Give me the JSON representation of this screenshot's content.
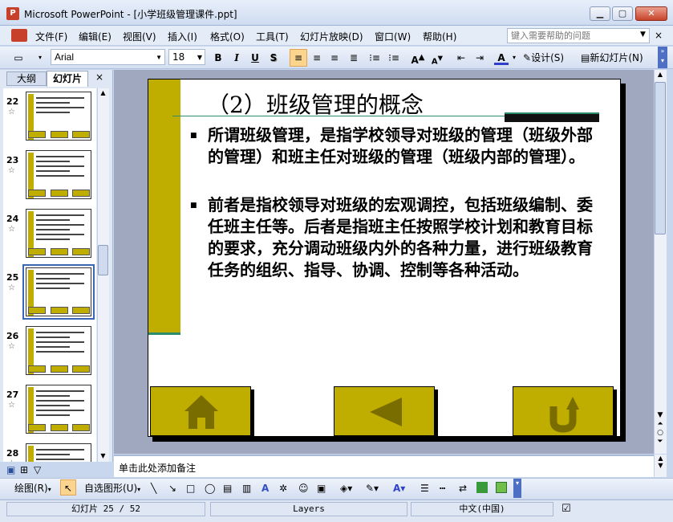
{
  "window": {
    "title": "Microsoft PowerPoint - [小学班级管理课件.ppt]",
    "app_icon": "P",
    "minimize": "▁",
    "maximize": "▢",
    "close": "✕"
  },
  "menu": {
    "items": [
      "文件(F)",
      "编辑(E)",
      "视图(V)",
      "插入(I)",
      "格式(O)",
      "工具(T)",
      "幻灯片放映(D)",
      "窗口(W)",
      "帮助(H)"
    ],
    "help_placeholder": "键入需要帮助的问题",
    "close": "×"
  },
  "toolbar": {
    "font": "Arial",
    "size": "18",
    "bold": "B",
    "italic": "I",
    "underline": "U",
    "shadow": "S",
    "design": "设计(S)",
    "new_slide": "新幻灯片(N)"
  },
  "left_panel": {
    "tab_outline": "大纲",
    "tab_slides": "幻灯片",
    "close": "×",
    "thumbnails": [
      {
        "number": "22",
        "star": "☆"
      },
      {
        "number": "23",
        "star": "☆"
      },
      {
        "number": "24",
        "star": "☆"
      },
      {
        "number": "25",
        "star": "☆",
        "selected": true
      },
      {
        "number": "26",
        "star": "☆"
      },
      {
        "number": "27",
        "star": "☆"
      },
      {
        "number": "28",
        "star": "☆"
      }
    ]
  },
  "slide": {
    "title": "（2）班级管理的概念",
    "bullet_char": "■",
    "paragraphs": [
      "所谓班级管理，是指学校领导对班级的管理（班级外部的管理）和班主任对班级的管理（班级内部的管理）。",
      "前者是指校领导对班级的宏观调控，包括班级编制、委任班主任等。后者是指班主任按照学校计划和教育目标的要求，充分调动班级内外的各种力量，进行班级教育任务的组织、指导、协调、控制等各种活动。"
    ],
    "accent_color": "#bfad00"
  },
  "notes": {
    "placeholder": "单击此处添加备注"
  },
  "drawing_toolbar": {
    "draw": "绘图(R)",
    "autoshapes": "自选图形(U)"
  },
  "status": {
    "slide_info": "幻灯片 25 / 52",
    "design": "Layers",
    "language": "中文(中国)"
  }
}
